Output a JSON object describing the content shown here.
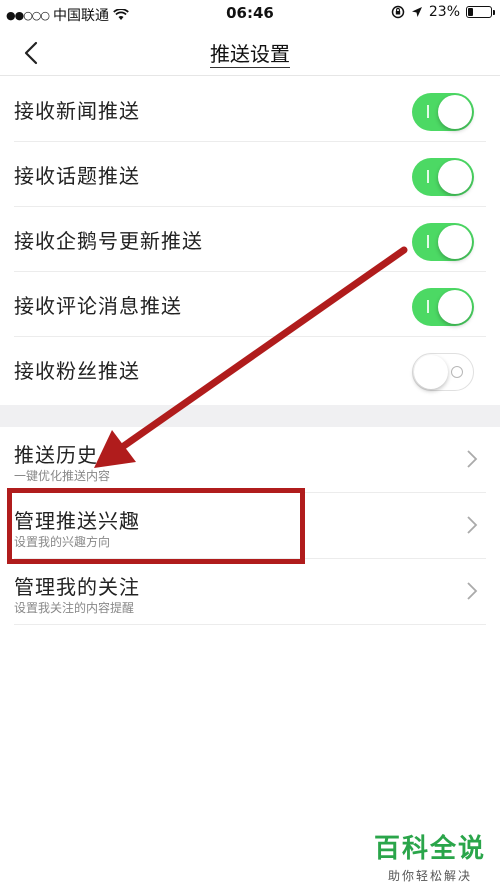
{
  "status_bar": {
    "carrier": "中国联通",
    "time": "06:46",
    "battery": "23%",
    "battery_level": 0.23,
    "signal_icon": "signal-dots-icon",
    "wifi_icon": "wifi-icon",
    "lock_icon": "rotation-lock-icon",
    "location_icon": "location-arrow-icon"
  },
  "nav": {
    "title": "推送设置",
    "back_icon": "chevron-left-icon"
  },
  "toggles": [
    {
      "label": "接收新闻推送",
      "on": true
    },
    {
      "label": "接收话题推送",
      "on": true
    },
    {
      "label": "接收企鹅号更新推送",
      "on": true
    },
    {
      "label": "接收评论消息推送",
      "on": true
    },
    {
      "label": "接收粉丝推送",
      "on": false
    }
  ],
  "links": [
    {
      "title": "推送历史",
      "subtitle": "一键优化推送内容"
    },
    {
      "title": "管理推送兴趣",
      "subtitle": "设置我的兴趣方向"
    },
    {
      "title": "管理我的关注",
      "subtitle": "设置我关注的内容提醒"
    }
  ],
  "colors": {
    "toggle_on": "#4cd964",
    "annotation": "#b01c1c",
    "watermark": "#2aa54a"
  },
  "watermark": {
    "main": "百科全说",
    "sub": "助你轻松解决"
  }
}
